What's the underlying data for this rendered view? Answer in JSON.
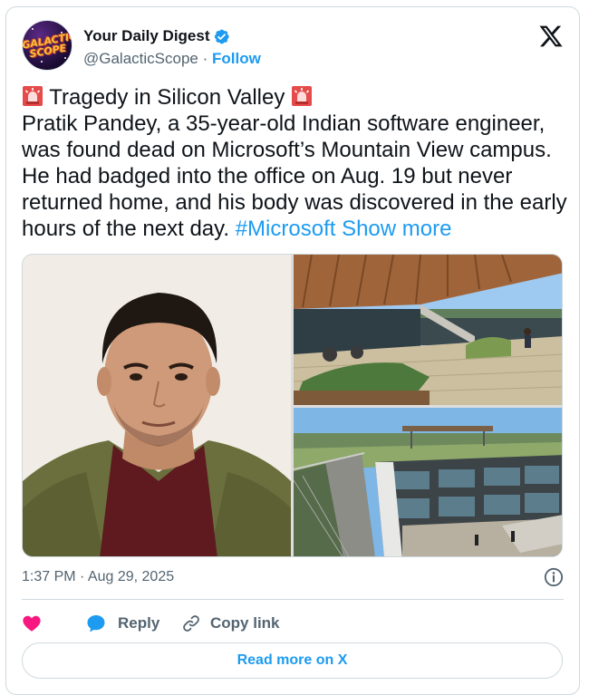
{
  "author": {
    "display_name": "Your Daily Digest",
    "handle": "@GalacticScope",
    "separator": " · ",
    "follow_label": "Follow",
    "avatar_text": "GALACTIC SCOPE",
    "verified": true
  },
  "post": {
    "headline": "Tragedy in Silicon Valley",
    "headline_emoji": "rotating-light-icon",
    "body_lines": [
      "Pratik Pandey, a 35-year-old Indian software engineer,",
      "was found dead on Microsoft’s Mountain View campus.",
      "He had badged into the office on Aug. 19 but never",
      "returned home, and his body was discovered in the early"
    ],
    "last_line_text": "hours of the next day. ",
    "hashtag": "#Microsoft",
    "show_more": "Show more"
  },
  "media": [
    {
      "icon": "portrait-photo"
    },
    {
      "icon": "office-patio-photo"
    },
    {
      "icon": "campus-courtyard-photo"
    }
  ],
  "meta": {
    "timestamp": "1:37 PM · Aug 29, 2025"
  },
  "actions": {
    "reply_label": "Reply",
    "copy_link_label": "Copy link"
  },
  "read_more_label": "Read more on X",
  "colors": {
    "accent": "#1d9bf0",
    "text": "#0f1419",
    "muted": "#536471",
    "like": "#f91880",
    "border": "#cfd9de"
  }
}
